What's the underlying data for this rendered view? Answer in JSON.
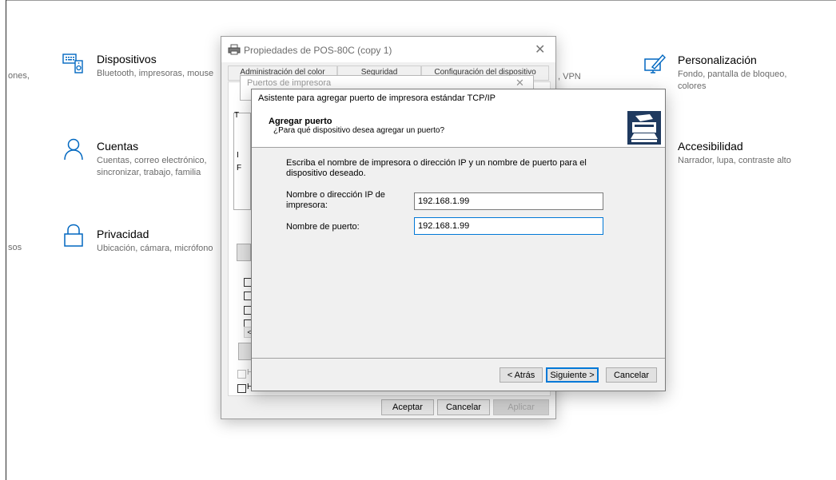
{
  "settings": {
    "cut_left_1": "ones,",
    "cut_left_2": "sos",
    "categories": [
      {
        "title": "Dispositivos",
        "desc": "Bluetooth, impresoras, mouse"
      },
      {
        "title": "Cuentas",
        "desc": "Cuentas, correo electrónico, sincronizar, trabajo, familia"
      },
      {
        "title": "Privacidad",
        "desc": "Ubicación, cámara, micrófono"
      },
      {
        "title": "Personalización",
        "desc": "Fondo, pantalla de bloqueo, colores"
      },
      {
        "title": "Accesibilidad",
        "desc": "Narrador, lupa, contraste alto"
      }
    ],
    "partial_vpn": ", VPN"
  },
  "properties_window": {
    "title": "Propiedades de POS-80C (copy 1)",
    "tabs": [
      "Administración del color",
      "Seguridad",
      "Configuración del dispositivo"
    ],
    "scroll_left": "<",
    "buttons": {
      "accept": "Aceptar",
      "cancel": "Cancelar",
      "apply": "Aplicar"
    },
    "fragments": {
      "t": "T",
      "i": "I",
      "f": "F",
      "h1": "H",
      "h2": "H"
    }
  },
  "ports_window": {
    "title": "Puertos de impresora"
  },
  "wizard": {
    "title": "Asistente para agregar puerto de impresora estándar TCP/IP",
    "header_title": "Agregar puerto",
    "header_subtitle": "¿Para qué dispositivo desea agregar un puerto?",
    "instruction": "Escriba el nombre de impresora o dirección IP y un nombre de puerto para el dispositivo deseado.",
    "ip_label": "Nombre o dirección IP de impresora:",
    "ip_value": "192.168.1.99",
    "port_label": "Nombre de puerto:",
    "port_value": "192.168.1.99",
    "buttons": {
      "back": "< Atrás",
      "next": "Siguiente >",
      "cancel": "Cancelar"
    }
  }
}
